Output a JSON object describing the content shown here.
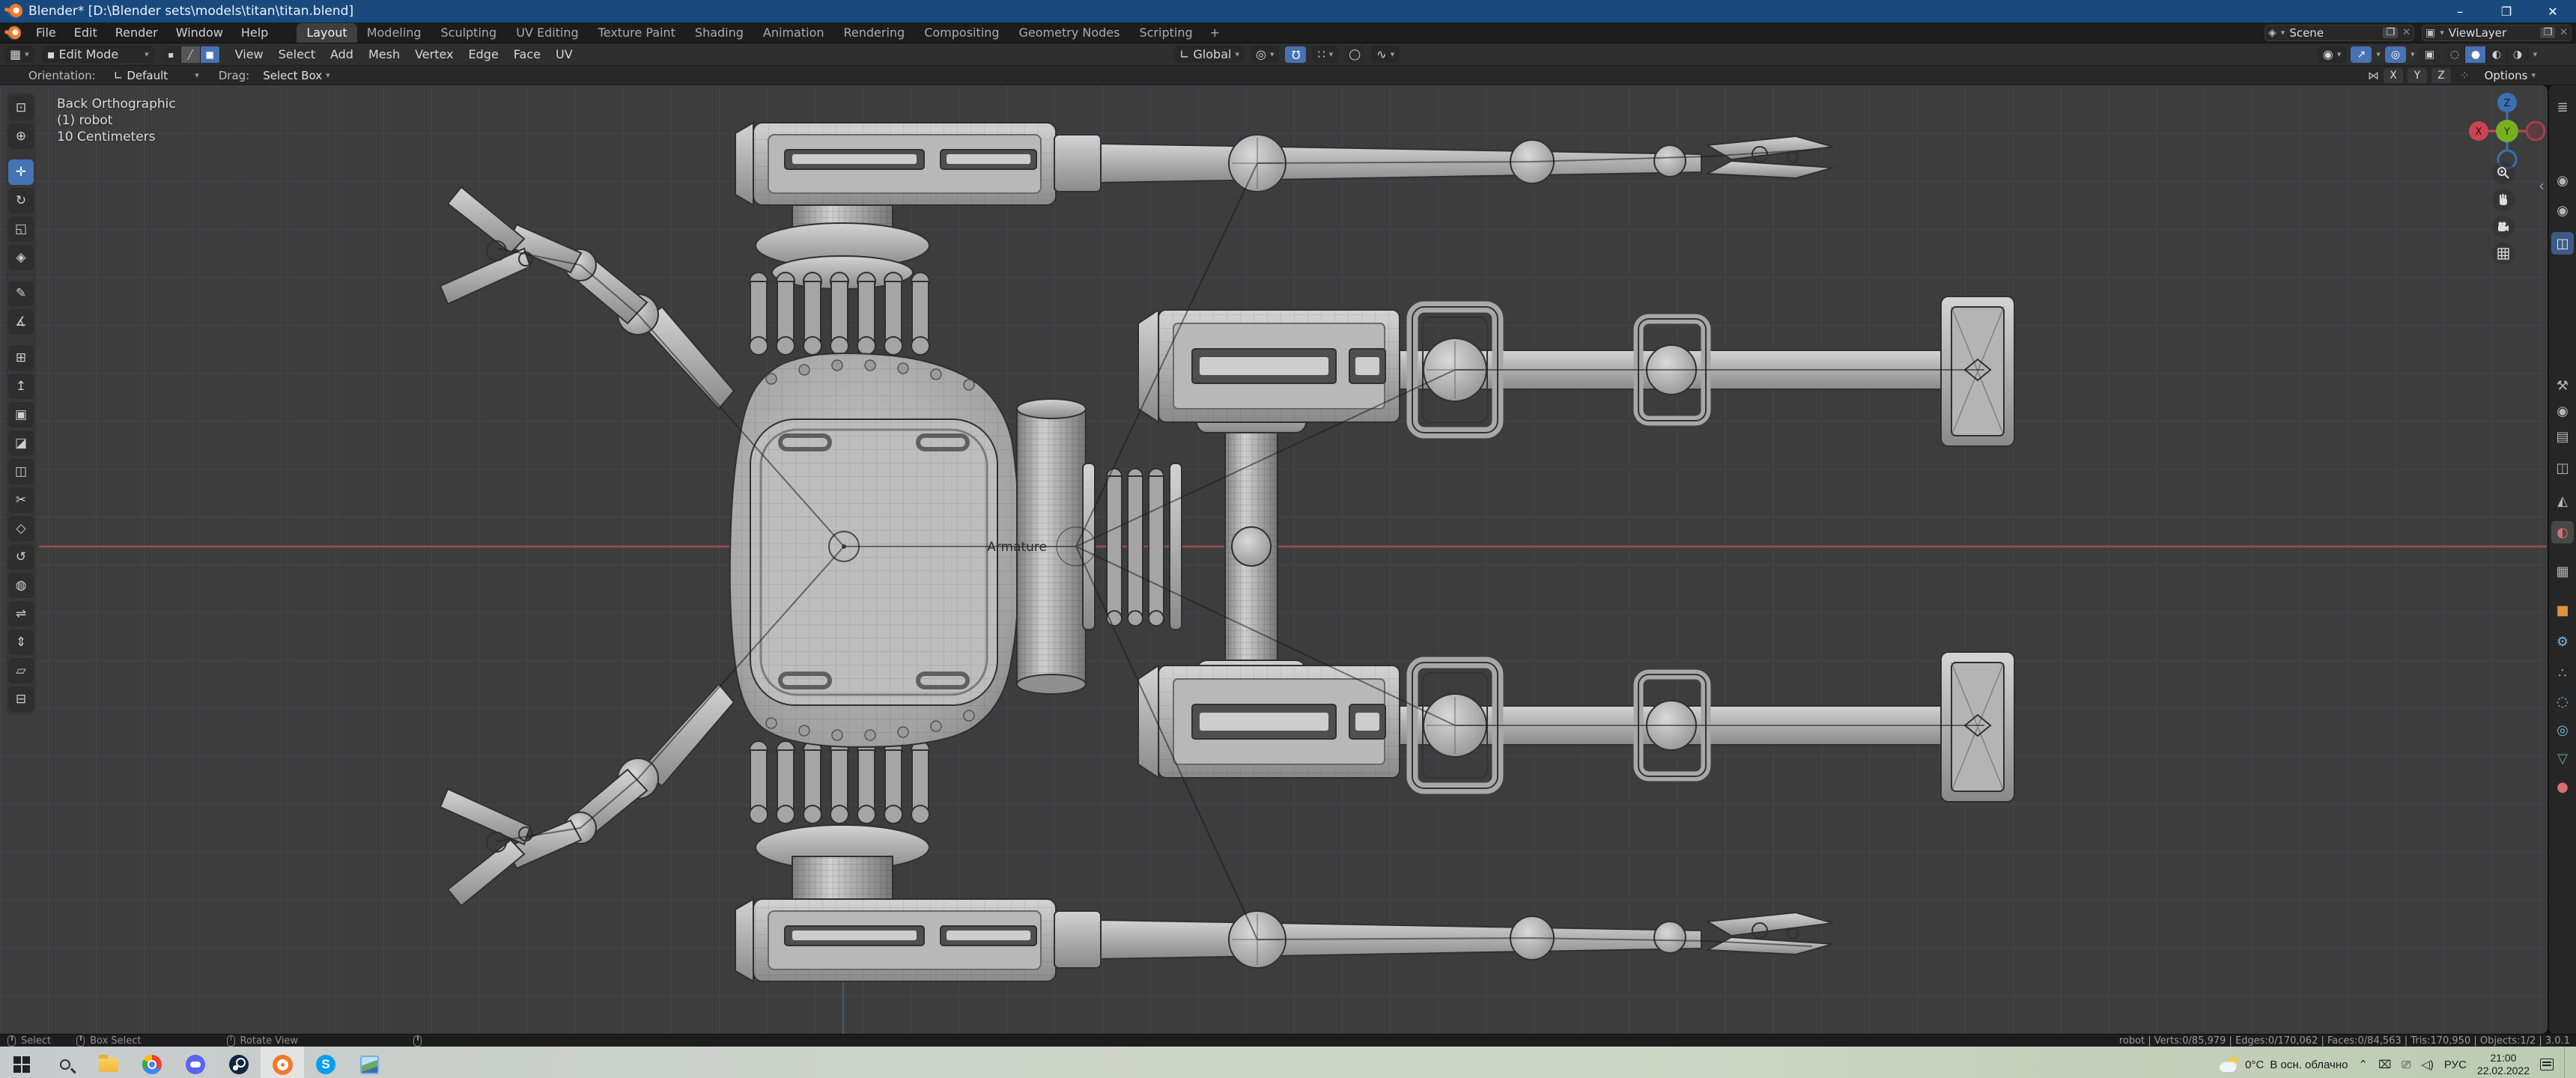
{
  "window": {
    "title": "Blender* [D:\\Blender sets\\models\\titan\\titan.blend]"
  },
  "icons": {
    "minimize": "–",
    "maximize": "❐",
    "close": "✕",
    "chevron": "▾",
    "collapse": "‹",
    "copy": "❐",
    "delete": "✕",
    "scene": "◈",
    "viewlayer": "▣",
    "editor_type": "▦",
    "vertex_mode": "▪",
    "edge_mode": "╱",
    "face_mode": "■",
    "orientation_axis": "∟",
    "pivot": "◎",
    "magnet": "Ω",
    "snap_with": "∷",
    "proportional": "◯",
    "falloff": "∿",
    "visibility": "◉",
    "gizmo": "↗",
    "overlays": "◎",
    "xray": "▣",
    "shade_wire": "◌",
    "shade_solid": "●",
    "shade_material": "◐",
    "shade_render": "◑",
    "mirror": "⋈",
    "snap_target": "⁘"
  },
  "topbar": {
    "menus": [
      "File",
      "Edit",
      "Render",
      "Window",
      "Help"
    ],
    "workspaces": [
      "Layout",
      "Modeling",
      "Sculpting",
      "UV Editing",
      "Texture Paint",
      "Shading",
      "Animation",
      "Rendering",
      "Compositing",
      "Geometry Nodes",
      "Scripting"
    ],
    "active_workspace": "Layout",
    "add_workspace": "+",
    "scene_label": "Scene",
    "viewlayer_label": "ViewLayer"
  },
  "viewport_header": {
    "mode": "Edit Mode",
    "menus": [
      "View",
      "Select",
      "Add",
      "Mesh",
      "Vertex",
      "Edge",
      "Face",
      "UV"
    ],
    "transform_orientation": "Global",
    "options": "Options",
    "mirror_axes": [
      "X",
      "Y",
      "Z"
    ]
  },
  "tool_settings": {
    "orientation_label": "Orientation:",
    "orientation_value": "Default",
    "drag_label": "Drag:",
    "drag_value": "Select Box"
  },
  "viewport": {
    "view_name": "Back Orthographic",
    "object_name": "(1) robot",
    "grid_scale": "10 Centimeters",
    "armature_label": "Armature",
    "axis_x": "X",
    "axis_y": "Y",
    "axis_z": "Z"
  },
  "tools": [
    {
      "name": "select-box",
      "glyph": "⊡"
    },
    {
      "name": "cursor",
      "glyph": "⊕"
    },
    {
      "name": "move",
      "glyph": "✛"
    },
    {
      "name": "rotate",
      "glyph": "↻"
    },
    {
      "name": "scale",
      "glyph": "◱"
    },
    {
      "name": "transform",
      "glyph": "◈"
    },
    {
      "name": "annotate",
      "glyph": "✎"
    },
    {
      "name": "measure",
      "glyph": "∡"
    },
    {
      "name": "add-cube",
      "glyph": "⊞"
    },
    {
      "name": "extrude-region",
      "glyph": "↥"
    },
    {
      "name": "inset-faces",
      "glyph": "▣"
    },
    {
      "name": "bevel",
      "glyph": "◪"
    },
    {
      "name": "loop-cut",
      "glyph": "◫"
    },
    {
      "name": "knife",
      "glyph": "✂"
    },
    {
      "name": "poly-build",
      "glyph": "◇"
    },
    {
      "name": "spin",
      "glyph": "↺"
    },
    {
      "name": "smooth",
      "glyph": "◍"
    },
    {
      "name": "edge-slide",
      "glyph": "⇌"
    },
    {
      "name": "shrink-fatten",
      "glyph": "⇕"
    },
    {
      "name": "shear",
      "glyph": "▱"
    },
    {
      "name": "rip-region",
      "glyph": "⊟"
    }
  ],
  "outliner": {
    "icon_glyph": "≣"
  },
  "properties_tabs": {
    "top": [
      {
        "name": "render",
        "glyph": "◉"
      },
      {
        "name": "output",
        "glyph": "◉"
      },
      {
        "name": "view-layer",
        "glyph": "◫"
      }
    ],
    "main": [
      {
        "name": "tool",
        "glyph": "⚒",
        "color": "#bdbdbd"
      },
      {
        "name": "render",
        "glyph": "◉",
        "color": "#bdbdbd"
      },
      {
        "name": "output",
        "glyph": "▤",
        "color": "#bdbdbd"
      },
      {
        "name": "view-layer",
        "glyph": "◫",
        "color": "#bdbdbd"
      },
      {
        "name": "scene",
        "glyph": "◭",
        "color": "#cccccc"
      },
      {
        "name": "world",
        "glyph": "◐",
        "color": "#d76f6f"
      },
      {
        "name": "collection",
        "glyph": "▦",
        "color": "#bdbdbd"
      },
      {
        "name": "object",
        "glyph": "■",
        "color": "#e0913f"
      },
      {
        "name": "modifiers",
        "glyph": "⚙",
        "color": "#7fb3e0"
      },
      {
        "name": "particles",
        "glyph": "∴",
        "color": "#7fb3e0"
      },
      {
        "name": "physics",
        "glyph": "◌",
        "color": "#7fb3e0"
      },
      {
        "name": "constraints",
        "glyph": "◎",
        "color": "#7fb3e0"
      },
      {
        "name": "object-data",
        "glyph": "▽",
        "color": "#53c278"
      },
      {
        "name": "material",
        "glyph": "●",
        "color": "#d76f6f"
      }
    ]
  },
  "status": {
    "hint_select": "Select",
    "hint_box_select": "Box Select",
    "hint_rotate_view": "Rotate View",
    "stats": "robot | Verts:0/85,979 | Edges:0/170,062 | Faces:0/84,563 | Tris:170,950 | Objects:1/2 | 3.0.1"
  },
  "taskbar": {
    "temperature": "0°C",
    "weather": "В осн. облачно",
    "tray_chevron": "⌃",
    "tray_device": "⌧",
    "tray_network": "⎚",
    "tray_volume": "◁)",
    "language": "РУС",
    "time": "21:00",
    "date": "22.02.2022"
  },
  "colors": {
    "accent": "#4772b3",
    "axis_x": "#cc4452",
    "axis_y": "#76b021",
    "axis_z": "#3c70b0"
  }
}
